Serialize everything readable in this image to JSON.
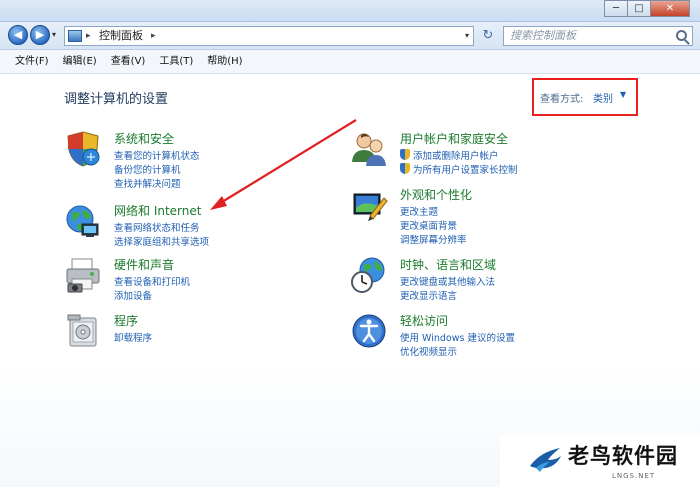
{
  "window": {
    "buttons": [
      "─",
      "□",
      "✕"
    ]
  },
  "nav": {
    "back": "◀",
    "forward": "▶",
    "history_dropdown": "▾",
    "address": {
      "sep1": "▸",
      "text": "控制面板",
      "sep2": "▸",
      "dropdown": "▾"
    },
    "refresh": "↻",
    "search_placeholder": "搜索控制面板"
  },
  "menu": [
    "文件(F)",
    "编辑(E)",
    "查看(V)",
    "工具(T)",
    "帮助(H)"
  ],
  "page": {
    "title": "调整计算机的设置",
    "view_by_label": "查看方式:",
    "view_by_value": "类别",
    "view_by_dropdown": "▼"
  },
  "categories_left": [
    {
      "icon": "shield-icon",
      "title": "系统和安全",
      "links": [
        "查看您的计算机状态",
        "备份您的计算机",
        "查找并解决问题"
      ]
    },
    {
      "icon": "network-globe-icon",
      "title": "网络和 Internet",
      "links": [
        "查看网络状态和任务",
        "选择家庭组和共享选项"
      ]
    },
    {
      "icon": "printer-icon",
      "title": "硬件和声音",
      "links": [
        "查看设备和打印机",
        "添加设备"
      ]
    },
    {
      "icon": "programs-icon",
      "title": "程序",
      "links": [
        "卸载程序"
      ]
    }
  ],
  "categories_right": [
    {
      "icon": "users-icon",
      "title": "用户帐户和家庭安全",
      "links": [
        "添加或删除用户帐户",
        "为所有用户设置家长控制"
      ]
    },
    {
      "icon": "appearance-icon",
      "title": "外观和个性化",
      "links": [
        "更改主题",
        "更改桌面背景",
        "调整屏幕分辨率"
      ]
    },
    {
      "icon": "clock-globe-icon",
      "title": "时钟、语言和区域",
      "links": [
        "更改键盘或其他输入法",
        "更改显示语言"
      ]
    },
    {
      "icon": "ease-of-access-icon",
      "title": "轻松访问",
      "links": [
        "使用 Windows 建议的设置",
        "优化视频显示"
      ]
    }
  ],
  "watermark": {
    "text": "老鸟软件园",
    "url": "LNGS.NET"
  },
  "colors": {
    "category_title": "#1a7a2c",
    "link": "#1f5fb2",
    "highlight_box": "#e8201e",
    "arrow": "#e02020"
  }
}
